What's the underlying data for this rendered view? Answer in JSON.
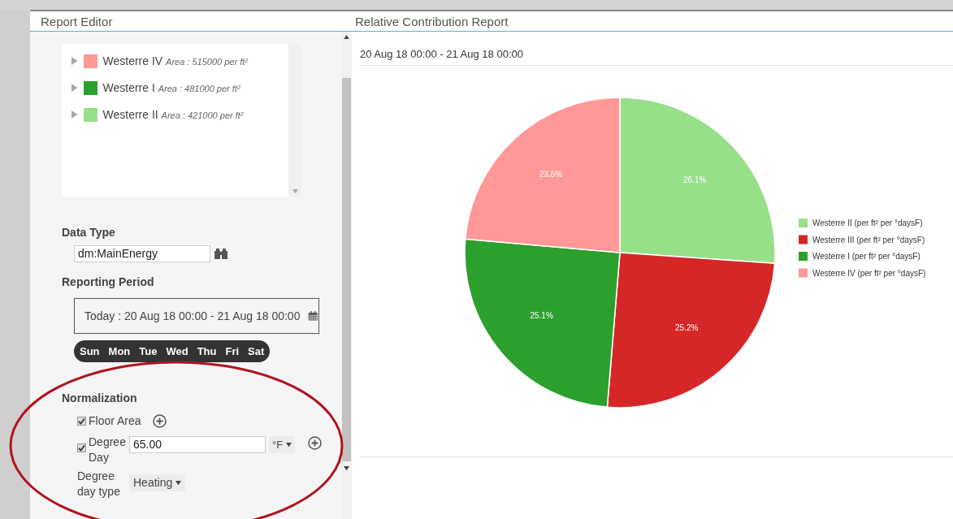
{
  "panels": {
    "left_title": "Report Editor",
    "right_title": "Relative Contribution Report"
  },
  "tree": {
    "items": [
      {
        "name": "Westerre IV",
        "detail": "Area : 515000 per ft²",
        "color": "#ff9896",
        "expanded": false
      },
      {
        "name": "Westerre I",
        "detail": "Area : 481000 per ft²",
        "color": "#2ca02c",
        "expanded": false
      },
      {
        "name": "Westerre II",
        "detail": "Area : 421000 per ft²",
        "color": "#98df8a",
        "expanded": false
      }
    ]
  },
  "data_type": {
    "label": "Data Type",
    "value": "dm:MainEnergy"
  },
  "reporting_period": {
    "label": "Reporting Period",
    "value": "Today : 20 Aug 18 00:00 - 21 Aug 18 00:00",
    "days": [
      "Sun",
      "Mon",
      "Tue",
      "Wed",
      "Thu",
      "Fri",
      "Sat"
    ]
  },
  "normalization": {
    "label": "Normalization",
    "floor_area": {
      "label": "Floor Area",
      "checked": true
    },
    "degree_day": {
      "label": "Degree Day",
      "checked": true,
      "value": "65.00",
      "unit": "°F"
    },
    "degree_day_type": {
      "label": "Degree day type",
      "value": "Heating"
    }
  },
  "report": {
    "period": "20 Aug 18 00:00 - 21 Aug 18 00:00",
    "chart_data": {
      "type": "pie",
      "categories": [
        "Westerre II (per ft² per °daysF)",
        "Westerre III (per ft² per °daysF)",
        "Westerre I (per ft² per °daysF)",
        "Westerre IV (per ft² per °daysF)"
      ],
      "legend": "right",
      "series": [
        {
          "colors": [
            "#98df8a",
            "#d62728",
            "#2ca02c",
            "#ff9896"
          ],
          "values": [
            26.1,
            25.2,
            25.1,
            23.6
          ]
        }
      ],
      "value_labels": [
        "26.1%",
        "25.2%",
        "25.1%",
        "23.6%"
      ]
    }
  }
}
